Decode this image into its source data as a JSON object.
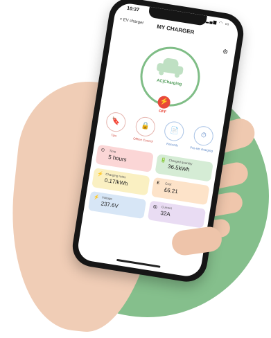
{
  "status": {
    "time": "10:37",
    "icons": "▂▄▆ ◠ ▭"
  },
  "nav": {
    "back": "< EV charger",
    "title": "MY CHARGER",
    "gear": "⚙"
  },
  "charger": {
    "state_label": "AC|Charging",
    "power_glyph": "⚡",
    "power_label": "OFF"
  },
  "actions": [
    {
      "label": "Tips",
      "glyph": "🔖"
    },
    {
      "label": "Offline Control",
      "glyph": "🔒"
    },
    {
      "label": "Records",
      "glyph": "📄"
    },
    {
      "label": "Pre-set charging",
      "glyph": "⏱"
    }
  ],
  "metrics": [
    {
      "label": "Time",
      "value": "5 hours",
      "glyph": "⏲"
    },
    {
      "label": "Charged quantity",
      "value": "36.5kWh",
      "glyph": "🔋"
    },
    {
      "label": "Charging rates",
      "value": "0.17/kWh",
      "glyph": "⚡"
    },
    {
      "label": "Cost",
      "value": "£6.21",
      "glyph": "£"
    },
    {
      "label": "Voltage",
      "value": "237.6V",
      "glyph": "⚡"
    },
    {
      "label": "Current",
      "value": "32A",
      "glyph": "◎"
    }
  ],
  "colors": {
    "brand_green": "#7fbd86",
    "alert_red": "#e8483b",
    "background_circle": "#85bf8c"
  }
}
